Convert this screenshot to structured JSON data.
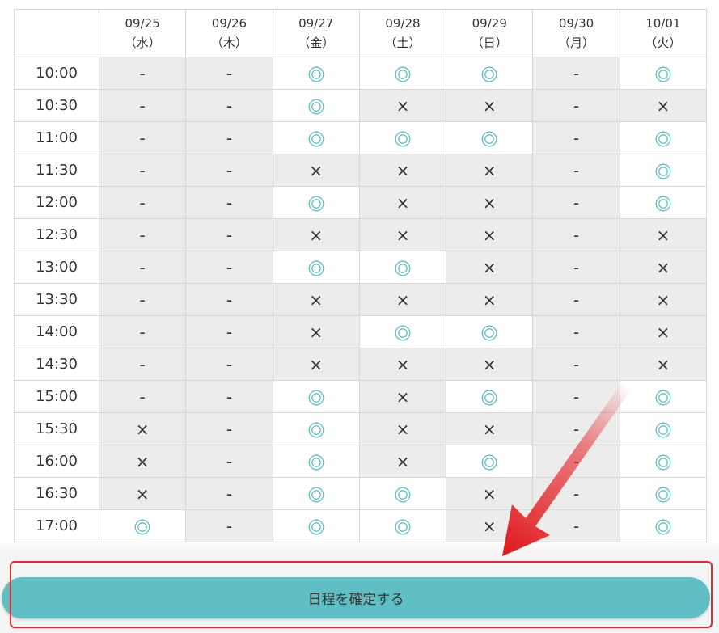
{
  "headers": {
    "corner": "",
    "dates": [
      {
        "date": "09/25",
        "weekday": "（水）"
      },
      {
        "date": "09/26",
        "weekday": "（木）"
      },
      {
        "date": "09/27",
        "weekday": "（金）"
      },
      {
        "date": "09/28",
        "weekday": "（土）"
      },
      {
        "date": "09/29",
        "weekday": "（日）"
      },
      {
        "date": "09/30",
        "weekday": "（月）"
      },
      {
        "date": "10/01",
        "weekday": "（火）"
      }
    ]
  },
  "legend_symbols": {
    "available": "◎",
    "full": "×",
    "closed": "-"
  },
  "rows": [
    {
      "time": "10:00",
      "slots": [
        "-",
        "-",
        "◎",
        "◎",
        "◎",
        "-",
        "◎"
      ]
    },
    {
      "time": "10:30",
      "slots": [
        "-",
        "-",
        "◎",
        "×",
        "×",
        "-",
        "×"
      ]
    },
    {
      "time": "11:00",
      "slots": [
        "-",
        "-",
        "◎",
        "◎",
        "◎",
        "-",
        "◎"
      ]
    },
    {
      "time": "11:30",
      "slots": [
        "-",
        "-",
        "×",
        "×",
        "×",
        "-",
        "◎"
      ]
    },
    {
      "time": "12:00",
      "slots": [
        "-",
        "-",
        "◎",
        "×",
        "×",
        "-",
        "◎"
      ]
    },
    {
      "time": "12:30",
      "slots": [
        "-",
        "-",
        "×",
        "×",
        "×",
        "-",
        "×"
      ]
    },
    {
      "time": "13:00",
      "slots": [
        "-",
        "-",
        "◎",
        "◎",
        "×",
        "-",
        "×"
      ]
    },
    {
      "time": "13:30",
      "slots": [
        "-",
        "-",
        "×",
        "×",
        "×",
        "-",
        "×"
      ]
    },
    {
      "time": "14:00",
      "slots": [
        "-",
        "-",
        "×",
        "◎",
        "◎",
        "-",
        "×"
      ]
    },
    {
      "time": "14:30",
      "slots": [
        "-",
        "-",
        "×",
        "×",
        "×",
        "-",
        "×"
      ]
    },
    {
      "time": "15:00",
      "slots": [
        "-",
        "-",
        "◎",
        "×",
        "◎",
        "-",
        "◎"
      ]
    },
    {
      "time": "15:30",
      "slots": [
        "×",
        "-",
        "◎",
        "×",
        "×",
        "-",
        "◎"
      ]
    },
    {
      "time": "16:00",
      "slots": [
        "×",
        "-",
        "◎",
        "×",
        "◎",
        "-",
        "◎"
      ]
    },
    {
      "time": "16:30",
      "slots": [
        "×",
        "-",
        "◎",
        "◎",
        "×",
        "-",
        "◎"
      ]
    },
    {
      "time": "17:00",
      "slots": [
        "◎",
        "-",
        "◎",
        "◎",
        "×",
        "-",
        "◎"
      ]
    }
  ],
  "confirm_button": {
    "label": "日程を確定する"
  },
  "colors": {
    "accent": "#5fbfc4",
    "available_mark": "#5fbfc4",
    "unavailable_bg": "#ececec",
    "annotation_red": "#e8262a"
  }
}
